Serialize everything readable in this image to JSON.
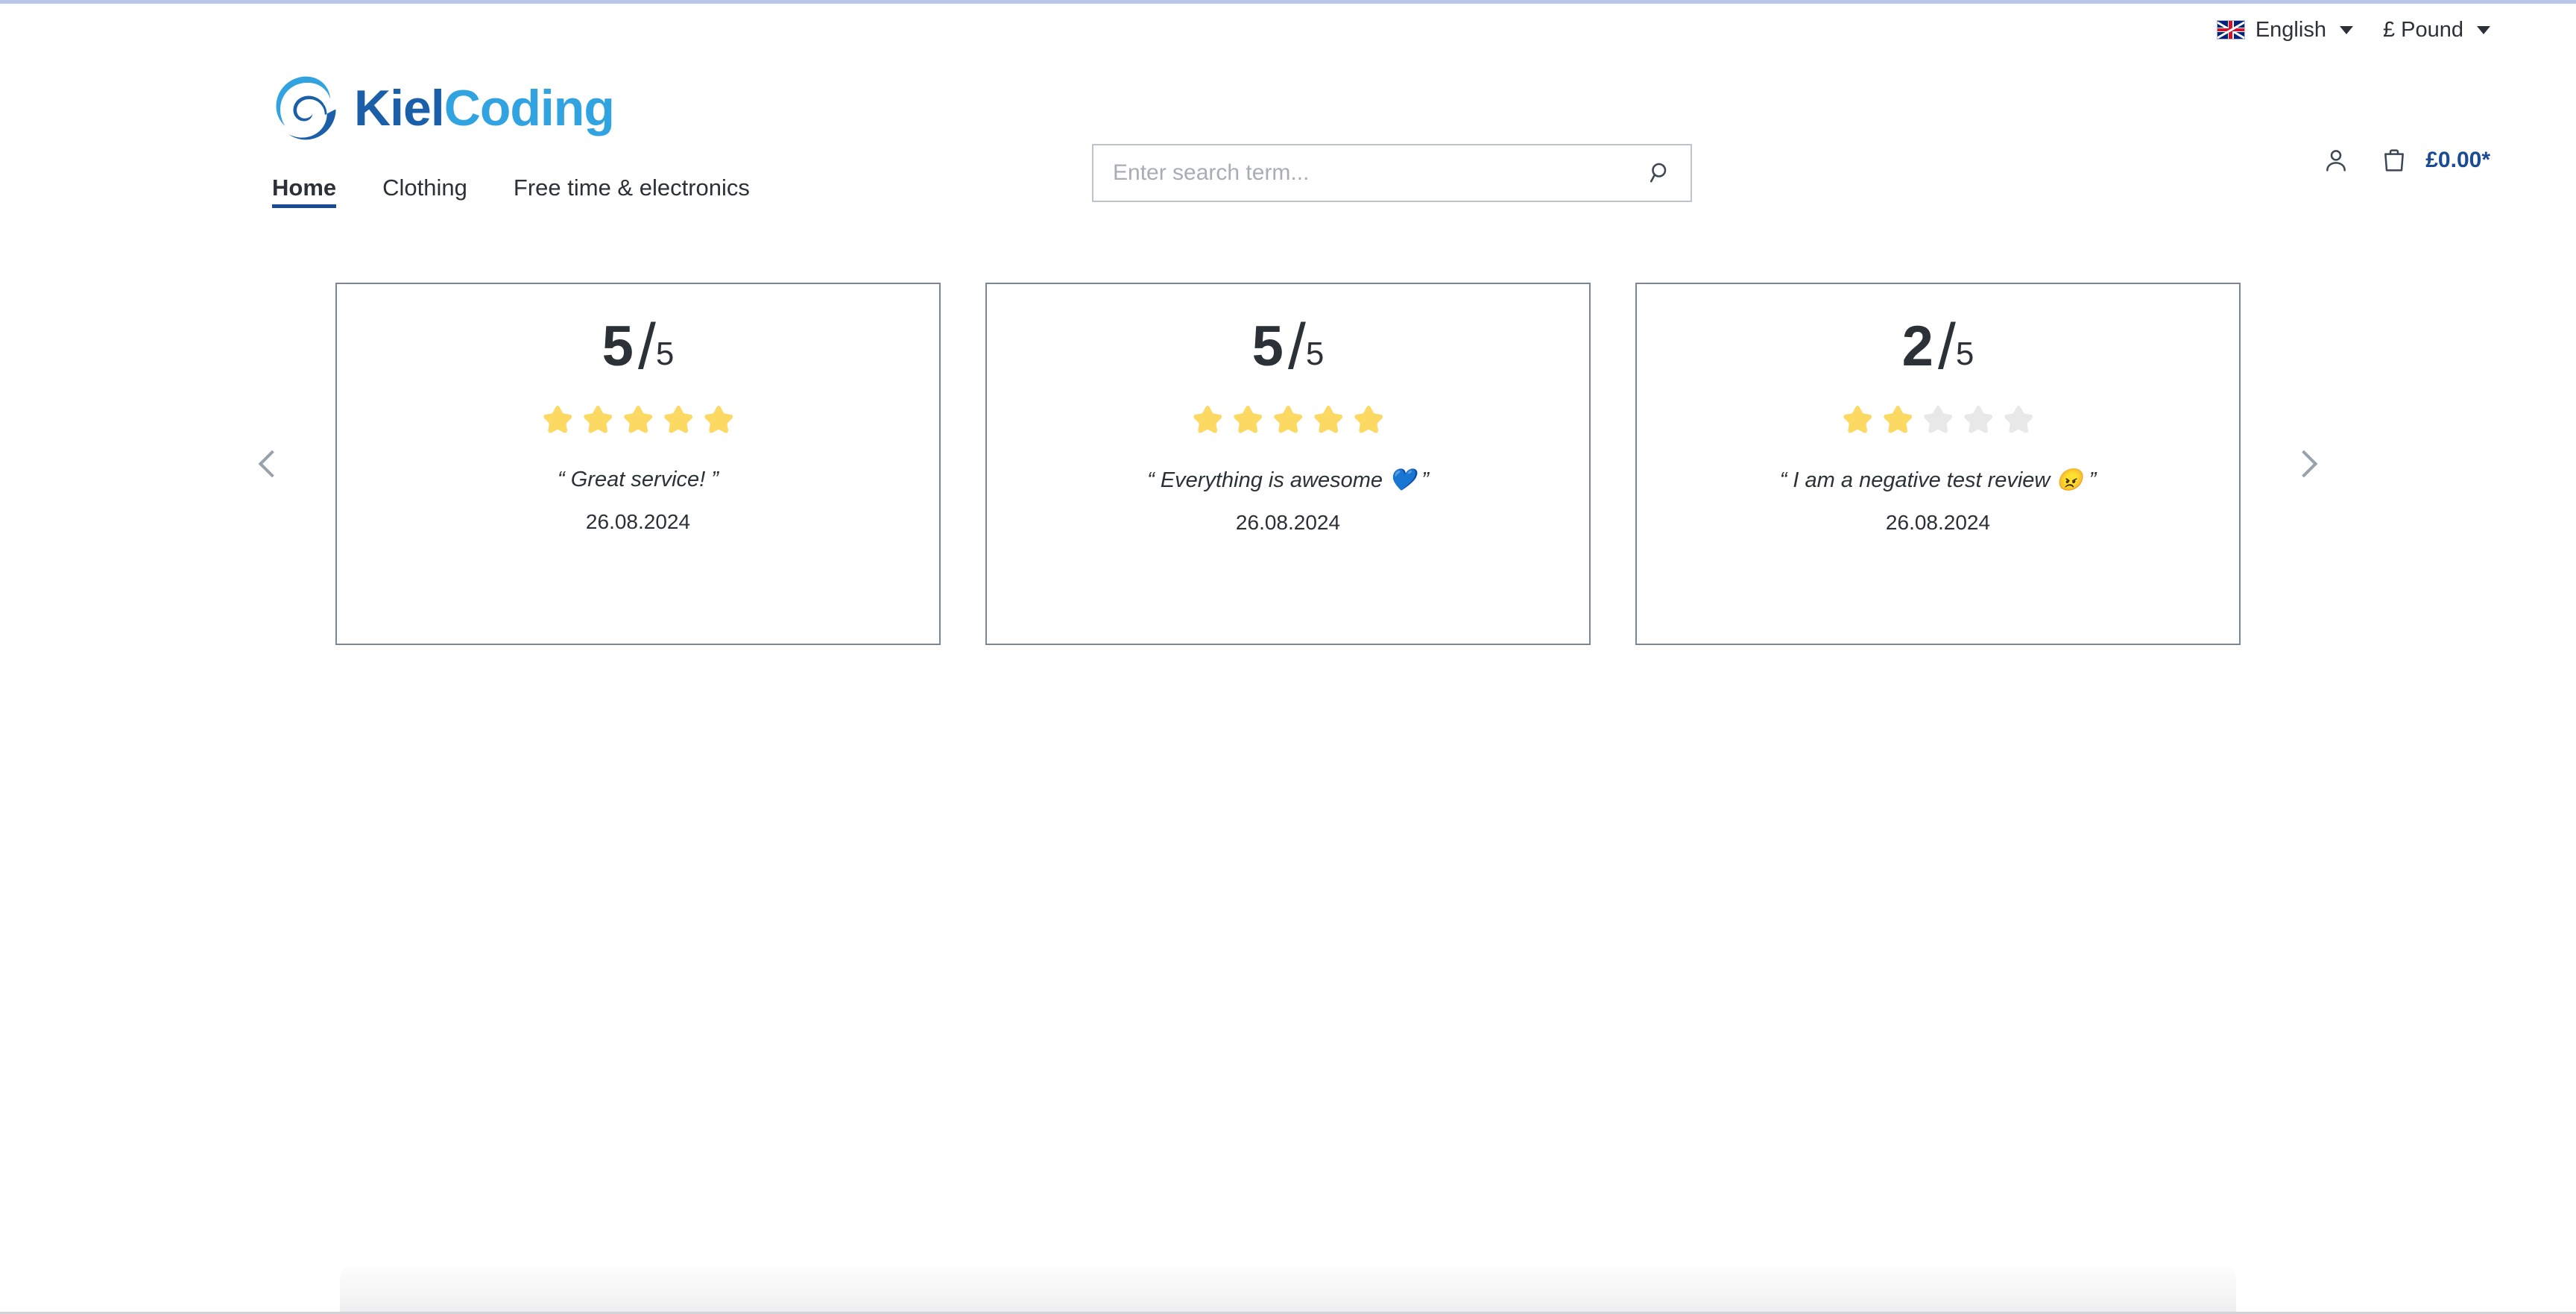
{
  "top_bar": {
    "language": {
      "label": "English",
      "flag_icon": "uk-flag-icon"
    },
    "currency": {
      "label": "£ Pound"
    }
  },
  "header": {
    "logo": {
      "part1": "Kiel",
      "part2": "Coding",
      "mark_icon": "wave-spiral-logo-icon"
    },
    "search": {
      "placeholder": "Enter search term...",
      "value": "",
      "icon": "search-icon"
    },
    "account": {
      "icon": "user-account-icon"
    },
    "cart": {
      "icon": "shopping-bag-icon",
      "amount": "£0.00*"
    }
  },
  "nav": {
    "items": [
      {
        "label": "Home",
        "active": true
      },
      {
        "label": "Clothing",
        "active": false
      },
      {
        "label": "Free time & electronics",
        "active": false
      }
    ]
  },
  "slider": {
    "prev_icon": "chevron-left-icon",
    "next_icon": "chevron-right-icon",
    "max_rating": "5",
    "quote_open": "“",
    "quote_close": "”",
    "reviews": [
      {
        "rating": "5",
        "max": "5",
        "stars_filled": 5,
        "stars_total": 5,
        "text": "“ Great service! ”",
        "date": "26.08.2024"
      },
      {
        "rating": "5",
        "max": "5",
        "stars_filled": 5,
        "stars_total": 5,
        "text": "“ Everything is awesome 💙 ”",
        "date": "26.08.2024"
      },
      {
        "rating": "2",
        "max": "5",
        "stars_filled": 2,
        "stars_total": 5,
        "text": "“ I am a negative test review 😠 ”",
        "date": "26.08.2024"
      }
    ]
  },
  "colors": {
    "accent_blue": "#1c4b96",
    "logo_light_blue": "#30a3e0",
    "star_filled": "#fbd963",
    "star_empty": "#e8e8e8",
    "card_border": "#798797",
    "text": "#2b3137"
  }
}
